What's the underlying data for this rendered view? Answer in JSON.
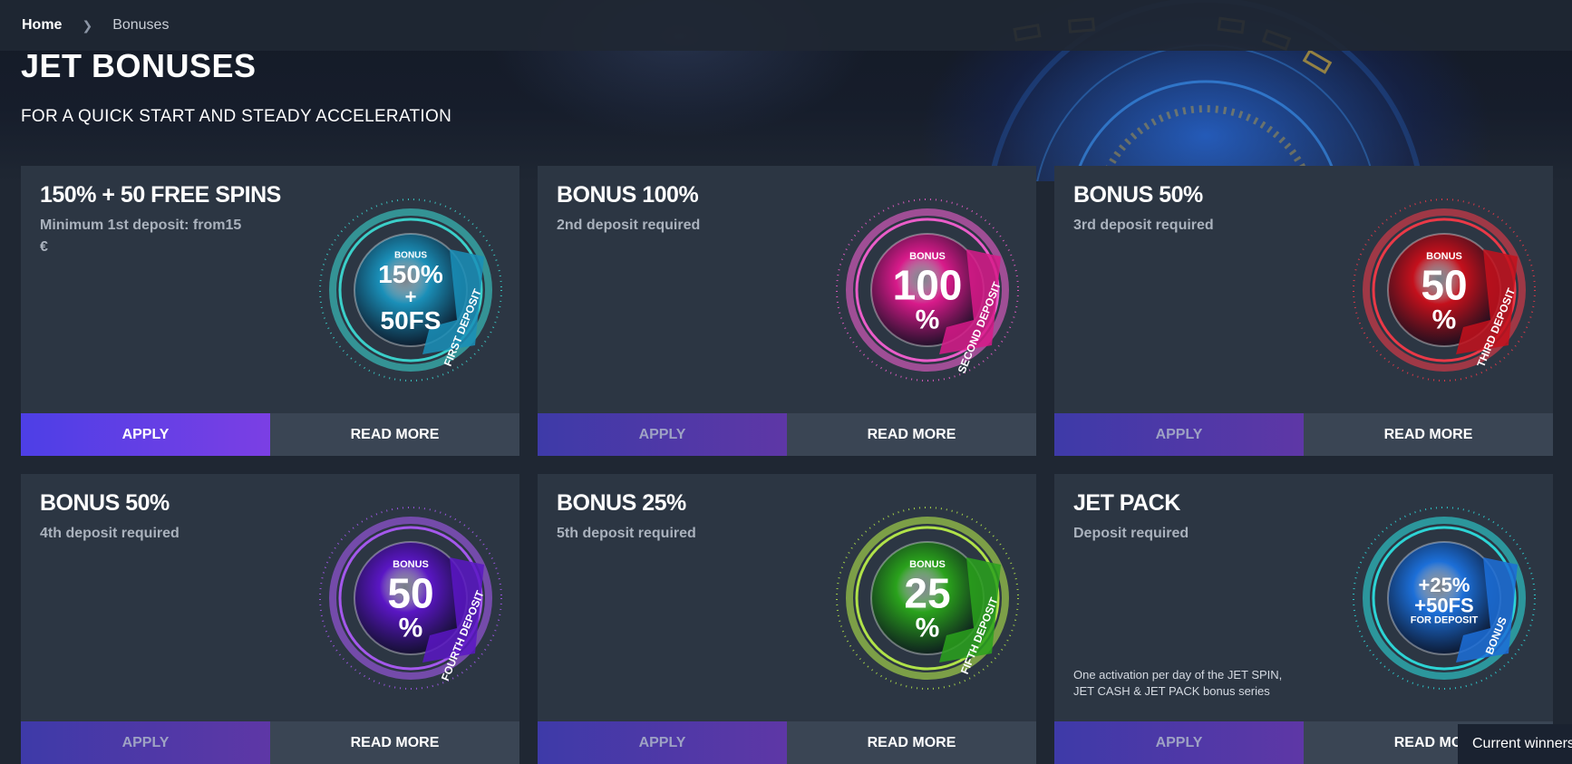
{
  "breadcrumb": {
    "home": "Home",
    "current": "Bonuses"
  },
  "page": {
    "title": "JET BONUSES",
    "subtitle": "FOR A QUICK START AND STEADY ACCELERATION"
  },
  "cards": [
    {
      "title": "150% + 50 FREE SPINS",
      "subtitle": "Minimum 1st deposit: from15 €",
      "note": "",
      "badge": {
        "top": "BONUS",
        "line1": "150%",
        "line2": "+",
        "line3": "50FS",
        "ribbon": "FIRST DEPOSIT",
        "color": "#1a8fb8",
        "glow": "#3de0d8"
      },
      "apply_label": "APPLY",
      "read_more_label": "READ MORE",
      "apply_active": true
    },
    {
      "title": "BONUS 100%",
      "subtitle": "2nd deposit required",
      "note": "",
      "badge": {
        "top": "BONUS",
        "line1": "100",
        "line2": "%",
        "line3": "",
        "ribbon": "SECOND DEPOSIT",
        "color": "#d81a8a",
        "glow": "#ff62d8"
      },
      "apply_label": "APPLY",
      "read_more_label": "READ MORE",
      "apply_active": false
    },
    {
      "title": "BONUS 50%",
      "subtitle": "3rd deposit required",
      "note": "",
      "badge": {
        "top": "BONUS",
        "line1": "50",
        "line2": "%",
        "line3": "",
        "ribbon": "THIRD DEPOSIT",
        "color": "#c4101c",
        "glow": "#ff3a48"
      },
      "apply_label": "APPLY",
      "read_more_label": "READ MORE",
      "apply_active": false
    },
    {
      "title": "BONUS 50%",
      "subtitle": "4th deposit required",
      "note": "",
      "badge": {
        "top": "BONUS",
        "line1": "50",
        "line2": "%",
        "line3": "",
        "ribbon": "FOURTH DEPOSIT",
        "color": "#5a16c4",
        "glow": "#b15cff"
      },
      "apply_label": "APPLY",
      "read_more_label": "READ MORE",
      "apply_active": false
    },
    {
      "title": "BONUS 25%",
      "subtitle": "5th deposit required",
      "note": "",
      "badge": {
        "top": "BONUS",
        "line1": "25",
        "line2": "%",
        "line3": "",
        "ribbon": "FIFTH DEPOSIT",
        "color": "#2aa21c",
        "glow": "#bff54a"
      },
      "apply_label": "APPLY",
      "read_more_label": "READ MORE",
      "apply_active": false
    },
    {
      "title": "JET PACK",
      "subtitle": "Deposit required",
      "note": "One activation per day of the JET SPIN, JET CASH & JET PACK bonus series",
      "badge": {
        "top": "",
        "line1": "+25%",
        "line2": "+50FS",
        "line3": "FOR DEPOSIT",
        "ribbon": "BONUS",
        "color": "#1c6fd8",
        "glow": "#2ee6e6"
      },
      "apply_label": "APPLY",
      "read_more_label": "READ MO",
      "apply_active": false
    }
  ],
  "winners": {
    "label": "Current winners"
  }
}
